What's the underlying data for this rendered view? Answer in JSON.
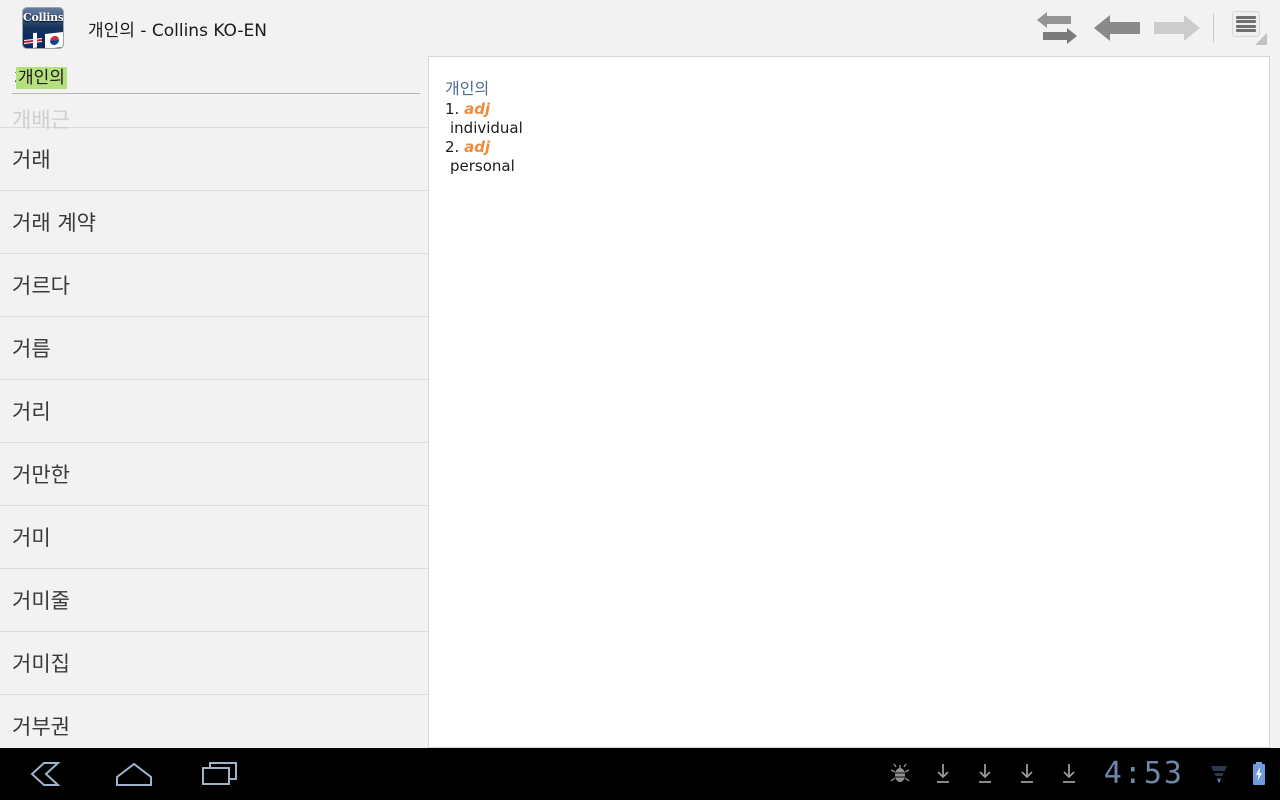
{
  "window": {
    "title": "개인의 - Collins KO-EN",
    "app_icon": "collins-dictionary-icon",
    "icon_word": "Collins"
  },
  "toolbar": {
    "items": [
      {
        "name": "swap-languages-button",
        "icon": "swap-arrows-icon",
        "state": "enabled"
      },
      {
        "name": "back-button",
        "icon": "arrow-left-icon",
        "state": "enabled"
      },
      {
        "name": "forward-button",
        "icon": "arrow-right-icon",
        "state": "disabled"
      },
      {
        "name": "menu-button",
        "icon": "hamburger-menu-icon",
        "state": "enabled"
      }
    ]
  },
  "search": {
    "value": "개인의",
    "placeholder": "",
    "selected_text": "개인의",
    "selection_color": "#b5e07e"
  },
  "word_list": {
    "clipped_top_item": "개배근",
    "items": [
      "거래",
      "거래 계약",
      "거르다",
      "거름",
      "거리",
      "거만한",
      "거미",
      "거미줄",
      "거미집",
      "거부권"
    ]
  },
  "entry": {
    "headword": "개인의",
    "headword_color": "#4a6d93",
    "pos_color": "#ef8b3c",
    "senses": [
      {
        "num": "1.",
        "pos": "adj",
        "translation": "individual"
      },
      {
        "num": "2.",
        "pos": "adj",
        "translation": "personal"
      }
    ]
  },
  "system_bar": {
    "nav": [
      {
        "name": "android-back-button",
        "icon": "back-chevron-icon"
      },
      {
        "name": "android-home-button",
        "icon": "home-icon"
      },
      {
        "name": "android-recents-button",
        "icon": "recent-apps-icon"
      }
    ],
    "status": {
      "debug_icon": "android-bug-icon",
      "download_count": 4,
      "download_icon": "download-arrow-icon",
      "time": "4:53",
      "signal_icon": "signal-triangle-icon",
      "battery_icon": "battery-charging-icon"
    }
  }
}
